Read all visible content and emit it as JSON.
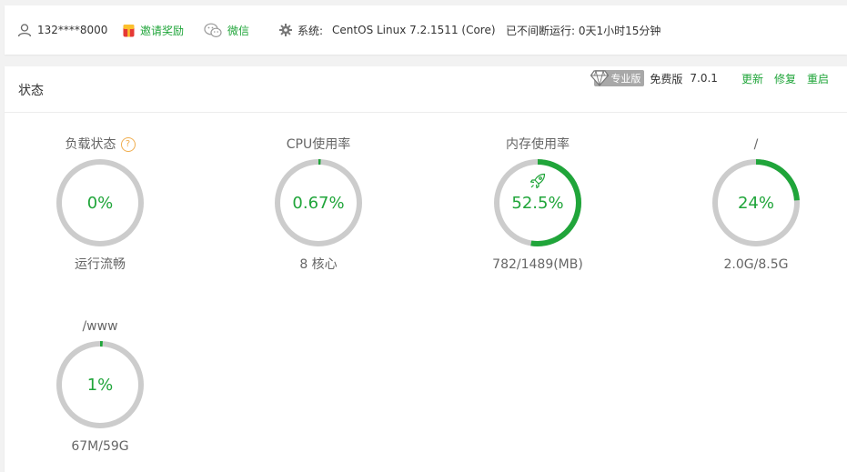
{
  "topbar": {
    "user": "132****8000",
    "invite_label": "邀请奖励",
    "wechat_label": "微信",
    "system_label": "系统:",
    "system_value": "CentOS Linux 7.2.1511 (Core)",
    "uptime": "已不间断运行: 0天1小时15分钟"
  },
  "panel": {
    "title": "状态",
    "version": {
      "pro_badge": "专业版",
      "edition": "免费版",
      "number": "7.0.1",
      "update": "更新",
      "repair": "修复",
      "restart": "重启"
    }
  },
  "colors": {
    "accent": "#20a53a",
    "track": "#cccccc",
    "help": "#f0ad4e"
  },
  "gauges": [
    {
      "title": "负载状态",
      "percent_text": "0%",
      "value": 0,
      "subtitle": "运行流畅",
      "help": "?"
    },
    {
      "title": "CPU使用率",
      "percent_text": "0.67%",
      "value": 0.67,
      "subtitle": "8 核心"
    },
    {
      "title": "内存使用率",
      "percent_text": "52.5%",
      "value": 52.5,
      "subtitle": "782/1489(MB)",
      "icon": "rocket-icon"
    },
    {
      "title": "/",
      "percent_text": "24%",
      "value": 24,
      "subtitle": "2.0G/8.5G"
    },
    {
      "title": "/www",
      "percent_text": "1%",
      "value": 1,
      "subtitle": "67M/59G"
    }
  ]
}
